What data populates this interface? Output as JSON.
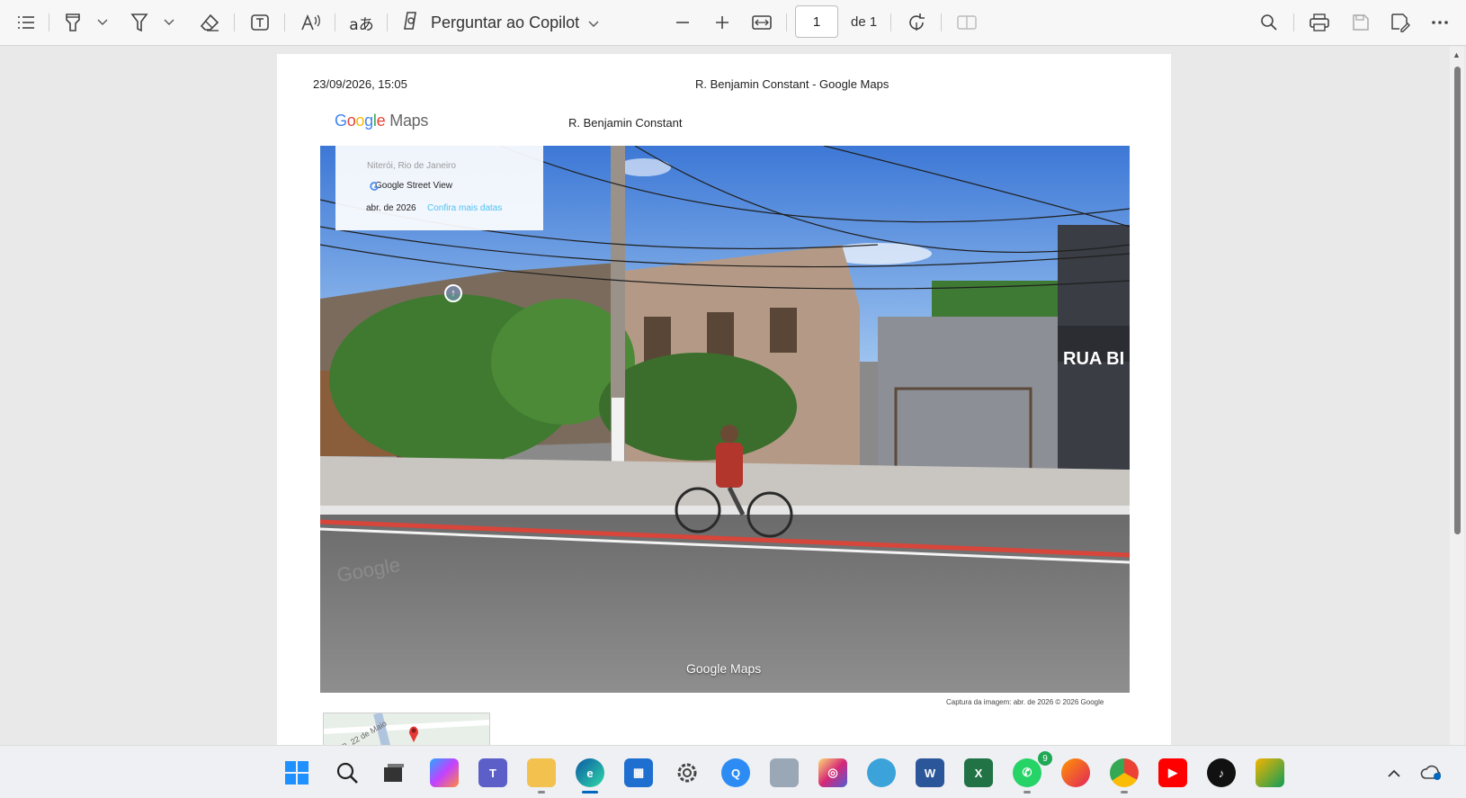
{
  "toolbar": {
    "copilot_label": "Perguntar ao Copilot",
    "page_current": "1",
    "page_total": "de 1",
    "icons": [
      "contents-icon",
      "highlight-icon",
      "draw-icon",
      "eraser-icon",
      "text-box-icon",
      "read-aloud-icon",
      "translate-icon",
      "copilot-icon",
      "zoom-out-icon",
      "zoom-in-icon",
      "fit-width-icon",
      "rotate-icon",
      "two-page-view-icon",
      "search-icon",
      "print-icon",
      "save-icon",
      "save-as-icon",
      "more-icon"
    ]
  },
  "document": {
    "header_date": "23/09/2026, 15:05",
    "header_title": "R. Benjamin Constant - Google Maps",
    "logo_text": "Google Maps",
    "street_name": "R. Benjamin Constant",
    "info_card": {
      "location": "Niterói, Rio de Janeiro",
      "service": "Google Street View",
      "date": "abr. de 2026",
      "link": "Confira mais datas"
    },
    "watermark": "Google Maps",
    "caption": "Captura da imagem: abr. de 2026    © 2026 Google",
    "sign_text": "RUA BI",
    "minimap_road": "R. 22 de Maio"
  },
  "taskbar": {
    "apps": [
      "windows-start",
      "search",
      "task-view",
      "copilot",
      "teams",
      "file-explorer",
      "edge",
      "microsoft-store",
      "settings",
      "quick-assist",
      "photos",
      "instagram",
      "maps",
      "word",
      "excel",
      "whatsapp",
      "firefox",
      "chrome",
      "youtube",
      "tiktok",
      "paint"
    ],
    "whatsapp_badge": "9"
  },
  "colors": {
    "accent": "#0067c0",
    "page_bg": "#e9e9e9"
  }
}
